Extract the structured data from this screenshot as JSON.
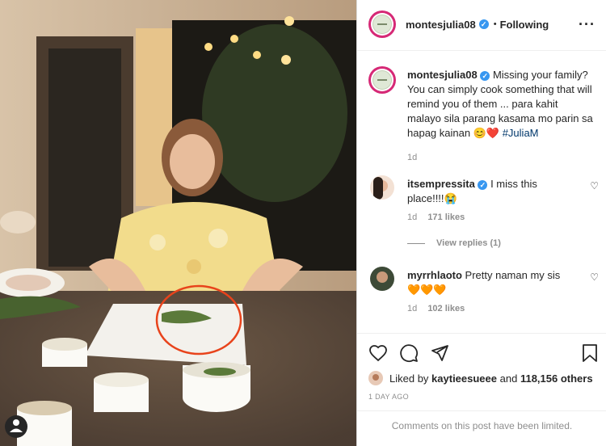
{
  "post": {
    "username": "montesjulia08",
    "follow_label": "Following",
    "separator": "•",
    "more_icon": "more-horizontal-icon"
  },
  "caption": {
    "username": "montesjulia08",
    "text": "Missing your family? You can simply cook something that will remind you of them ... para kahit malayo sila parang kasama mo parin sa hapag kainan",
    "emojis": "😊❤️",
    "hashtag": "#JuliaM",
    "time": "1d"
  },
  "comments": [
    {
      "username": "itsempressita",
      "text": "I miss this place!!!!😭",
      "time": "1d",
      "likes": "171 likes",
      "view_replies": "View replies (1)"
    },
    {
      "username": "myrrhlaoto",
      "text": "Pretty naman my sis",
      "emojis": "🧡🧡🧡",
      "time": "1d",
      "likes": "102 likes"
    }
  ],
  "actions": {
    "liked_by_prefix": "Liked by",
    "liked_by_user": "kaytieesueee",
    "liked_by_and": "and",
    "liked_by_count": "118,156 others",
    "date": "1 DAY AGO",
    "limited": "Comments on this post have been limited."
  },
  "colors": {
    "accent_ring": "#d62976",
    "verified": "#3897f0",
    "highlight_circle": "#e8431b"
  }
}
